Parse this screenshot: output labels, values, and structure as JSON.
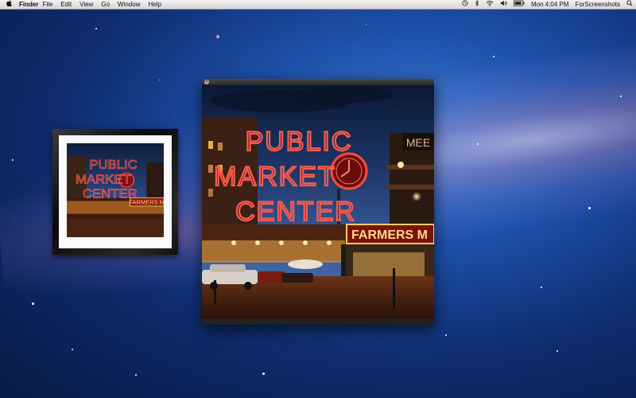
{
  "menubar": {
    "apple_icon": "apple-icon",
    "app_name": "Finder",
    "menus": [
      "File",
      "Edit",
      "View",
      "Go",
      "Window",
      "Help"
    ],
    "clock": "Mon 4:04 PM",
    "user": "ForScreenshots",
    "status_icons": [
      "time-machine-icon",
      "bluetooth-icon",
      "wifi-icon",
      "volume-icon",
      "battery-icon",
      "spotlight-icon"
    ]
  },
  "photo": {
    "sign_line1": "PUBLIC",
    "sign_line2": "MARKET",
    "sign_line3": "CENTER",
    "side_sign": "FARMERS M",
    "top_right_sign": "MEE"
  },
  "viewer": {
    "close_glyph": "×"
  },
  "colors": {
    "neon": "#ff4a3a",
    "neon_sign_side": "#ffcc66",
    "sky": "#1d3566"
  }
}
